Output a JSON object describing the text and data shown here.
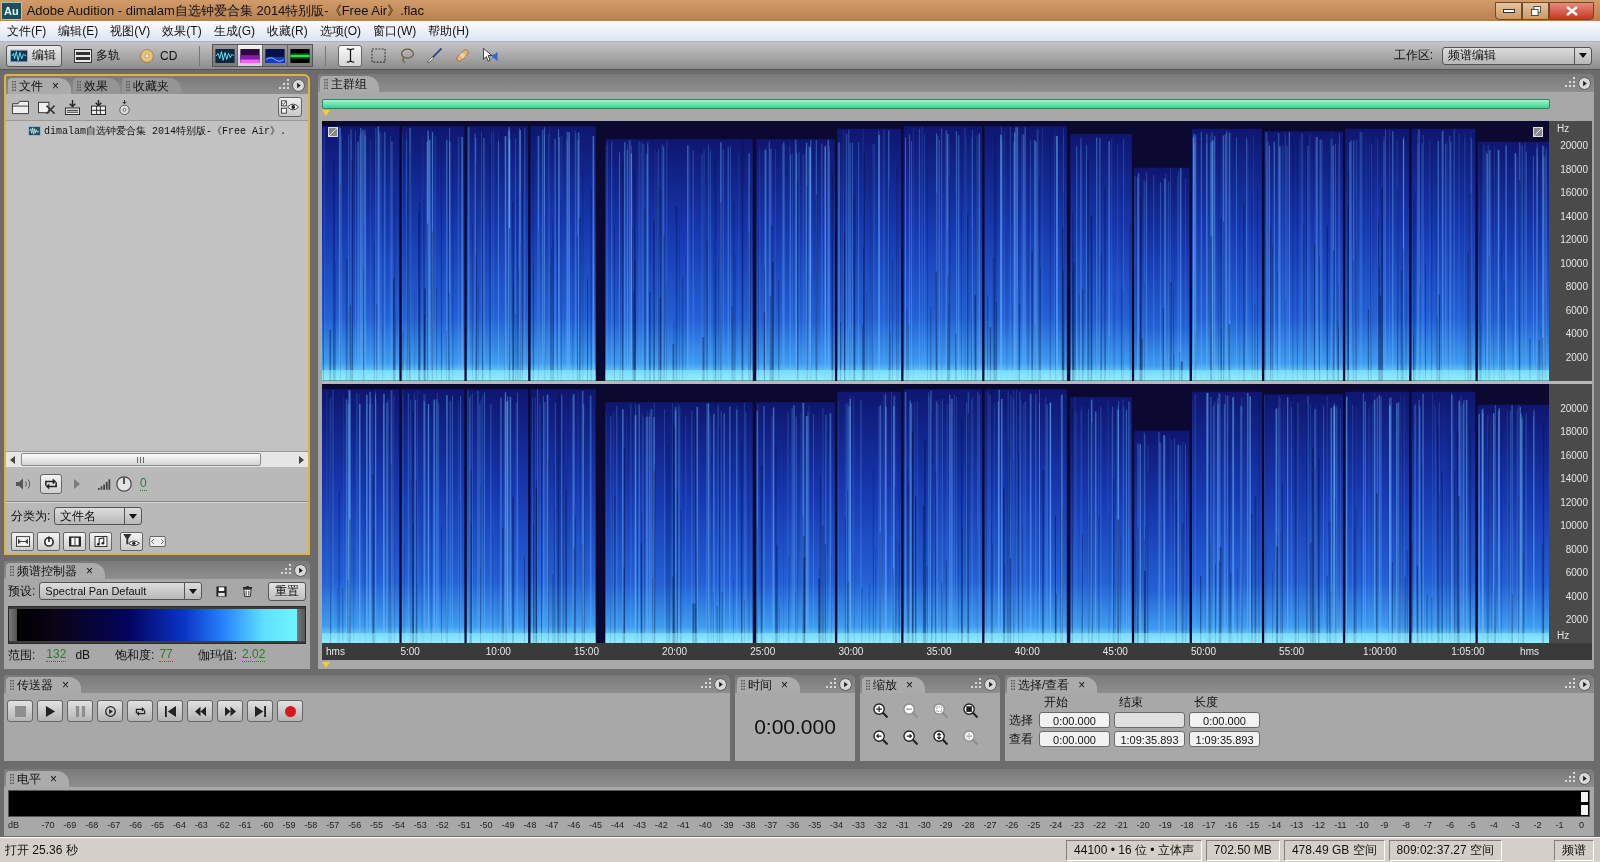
{
  "window": {
    "logo": "Au",
    "title": "Adobe Audition - dimalam自选钟爱合集 2014特别版-《Free Air》.flac"
  },
  "menu": [
    "文件(F)",
    "编辑(E)",
    "视图(V)",
    "效果(T)",
    "生成(G)",
    "收藏(R)",
    "选项(O)",
    "窗口(W)",
    "帮助(H)"
  ],
  "toolbar": {
    "modes": [
      {
        "kind": "edit",
        "label": "编辑",
        "selected": true
      },
      {
        "kind": "multitrack",
        "label": "多轨",
        "selected": false
      },
      {
        "kind": "cd",
        "label": "CD",
        "selected": false
      }
    ],
    "views": [
      {
        "kind": "waveform",
        "selected": false
      },
      {
        "kind": "spectral",
        "selected": true
      },
      {
        "kind": "pan",
        "selected": false
      },
      {
        "kind": "phase",
        "selected": false
      }
    ],
    "tools": [
      {
        "kind": "time-selection",
        "selected": true
      },
      {
        "kind": "marquee",
        "selected": false
      },
      {
        "kind": "lasso",
        "selected": false
      },
      {
        "kind": "brush",
        "selected": false
      },
      {
        "kind": "healing",
        "selected": false
      },
      {
        "kind": "scrub",
        "selected": false
      }
    ],
    "workspace": {
      "label": "工作区:",
      "value": "频谱编辑"
    }
  },
  "files_panel": {
    "tabs": [
      {
        "label": "文件",
        "close": "×",
        "selected": true
      },
      {
        "label": "效果",
        "selected": false
      },
      {
        "label": "收藏夹",
        "selected": false
      }
    ],
    "files": [
      {
        "name": "dimalam自选钟爱合集 2014特别版-《Free Air》."
      }
    ],
    "volume": "0",
    "sort": {
      "label": "分类为:",
      "value": "文件名"
    }
  },
  "spectral_panel": {
    "tab": {
      "label": "频谱控制器",
      "close": "×"
    },
    "preset": {
      "label": "预设:",
      "value": "Spectral Pan Default"
    },
    "reset": "重置",
    "range": {
      "label": "范围:",
      "value": "132",
      "unit": "dB"
    },
    "saturation": {
      "label": "饱和度:",
      "value": "77"
    },
    "gamma": {
      "label": "伽玛值:",
      "value": "2.02"
    }
  },
  "main_panel": {
    "tab": {
      "label": "主群组"
    },
    "channels": [
      {
        "top_unit": "Hz",
        "ticks": [
          "20000",
          "18000",
          "16000",
          "14000",
          "12000",
          "10000",
          "8000",
          "6000",
          "4000",
          "2000"
        ]
      },
      {
        "ticks": [
          "20000",
          "18000",
          "16000",
          "14000",
          "12000",
          "10000",
          "8000",
          "6000",
          "4000",
          "2000"
        ],
        "bottom_unit": "Hz"
      }
    ],
    "time_ruler": {
      "unit_start": "hms",
      "ticks": [
        "5:00",
        "10:00",
        "15:00",
        "20:00",
        "25:00",
        "30:00",
        "35:00",
        "40:00",
        "45:00",
        "50:00",
        "55:00",
        "1:00:00",
        "1:05:00"
      ],
      "unit_end": "hms"
    }
  },
  "transport": {
    "tab": {
      "label": "传送器",
      "close": "×"
    },
    "buttons": [
      {
        "kind": "stop",
        "disabled": true
      },
      {
        "kind": "play",
        "disabled": false
      },
      {
        "kind": "pause",
        "disabled": true
      },
      {
        "kind": "play-to-end",
        "disabled": false
      },
      {
        "kind": "loop",
        "disabled": false
      },
      {
        "kind": "go-start",
        "disabled": false
      },
      {
        "kind": "rewind",
        "disabled": false
      },
      {
        "kind": "forward",
        "disabled": false
      },
      {
        "kind": "go-end",
        "disabled": false
      },
      {
        "kind": "record",
        "disabled": false
      }
    ]
  },
  "time": {
    "tab": {
      "label": "时间",
      "close": "×"
    },
    "value": "0:00.000"
  },
  "zoom": {
    "tab": {
      "label": "缩放",
      "close": "×"
    },
    "buttons": [
      {
        "kind": "in-horizontal",
        "disabled": false
      },
      {
        "kind": "out-horizontal",
        "disabled": true
      },
      {
        "kind": "in-selection",
        "disabled": true
      },
      {
        "kind": "out-full",
        "disabled": false
      },
      {
        "kind": "in-left",
        "disabled": false
      },
      {
        "kind": "in-right",
        "disabled": false
      },
      {
        "kind": "in-vertical",
        "disabled": false
      },
      {
        "kind": "out-vertical",
        "disabled": true
      }
    ]
  },
  "selection": {
    "tab": {
      "label": "选择/查看",
      "close": "×"
    },
    "columns": [
      "开始",
      "结束",
      "长度"
    ],
    "rows": [
      {
        "label": "选择",
        "cells": [
          {
            "value": "0:00.000"
          },
          {},
          {
            "value": "0:00.000"
          }
        ]
      },
      {
        "label": "查看",
        "cells": [
          {
            "value": "0:00.000"
          },
          {
            "value": "1:09:35.893"
          },
          {
            "value": "1:09:35.893"
          }
        ]
      }
    ]
  },
  "level_meter": {
    "tab": {
      "label": "电平",
      "close": "×"
    },
    "unit": "dB",
    "ticks": [
      "-70",
      "-69",
      "-68",
      "-67",
      "-66",
      "-65",
      "-64",
      "-63",
      "-62",
      "-61",
      "-60",
      "-59",
      "-58",
      "-57",
      "-56",
      "-55",
      "-54",
      "-53",
      "-52",
      "-51",
      "-50",
      "-49",
      "-48",
      "-47",
      "-46",
      "-45",
      "-44",
      "-43",
      "-42",
      "-41",
      "-40",
      "-39",
      "-38",
      "-37",
      "-36",
      "-35",
      "-34",
      "-33",
      "-32",
      "-31",
      "-30",
      "-29",
      "-28",
      "-27",
      "-26",
      "-25",
      "-24",
      "-23",
      "-22",
      "-21",
      "-20",
      "-19",
      "-18",
      "-17",
      "-16",
      "-15",
      "-14",
      "-13",
      "-12",
      "-11",
      "-10",
      "-9",
      "-8",
      "-7",
      "-6",
      "-5",
      "-4",
      "-3",
      "-2",
      "-1",
      "0"
    ]
  },
  "status_bar": {
    "message": "打开 25.36 秒",
    "cells": [
      "44100 • 16 位 • 立体声",
      "702.50 MB",
      "478.49 GB 空间",
      "809:02:37.27 空间",
      "频谱"
    ]
  }
}
